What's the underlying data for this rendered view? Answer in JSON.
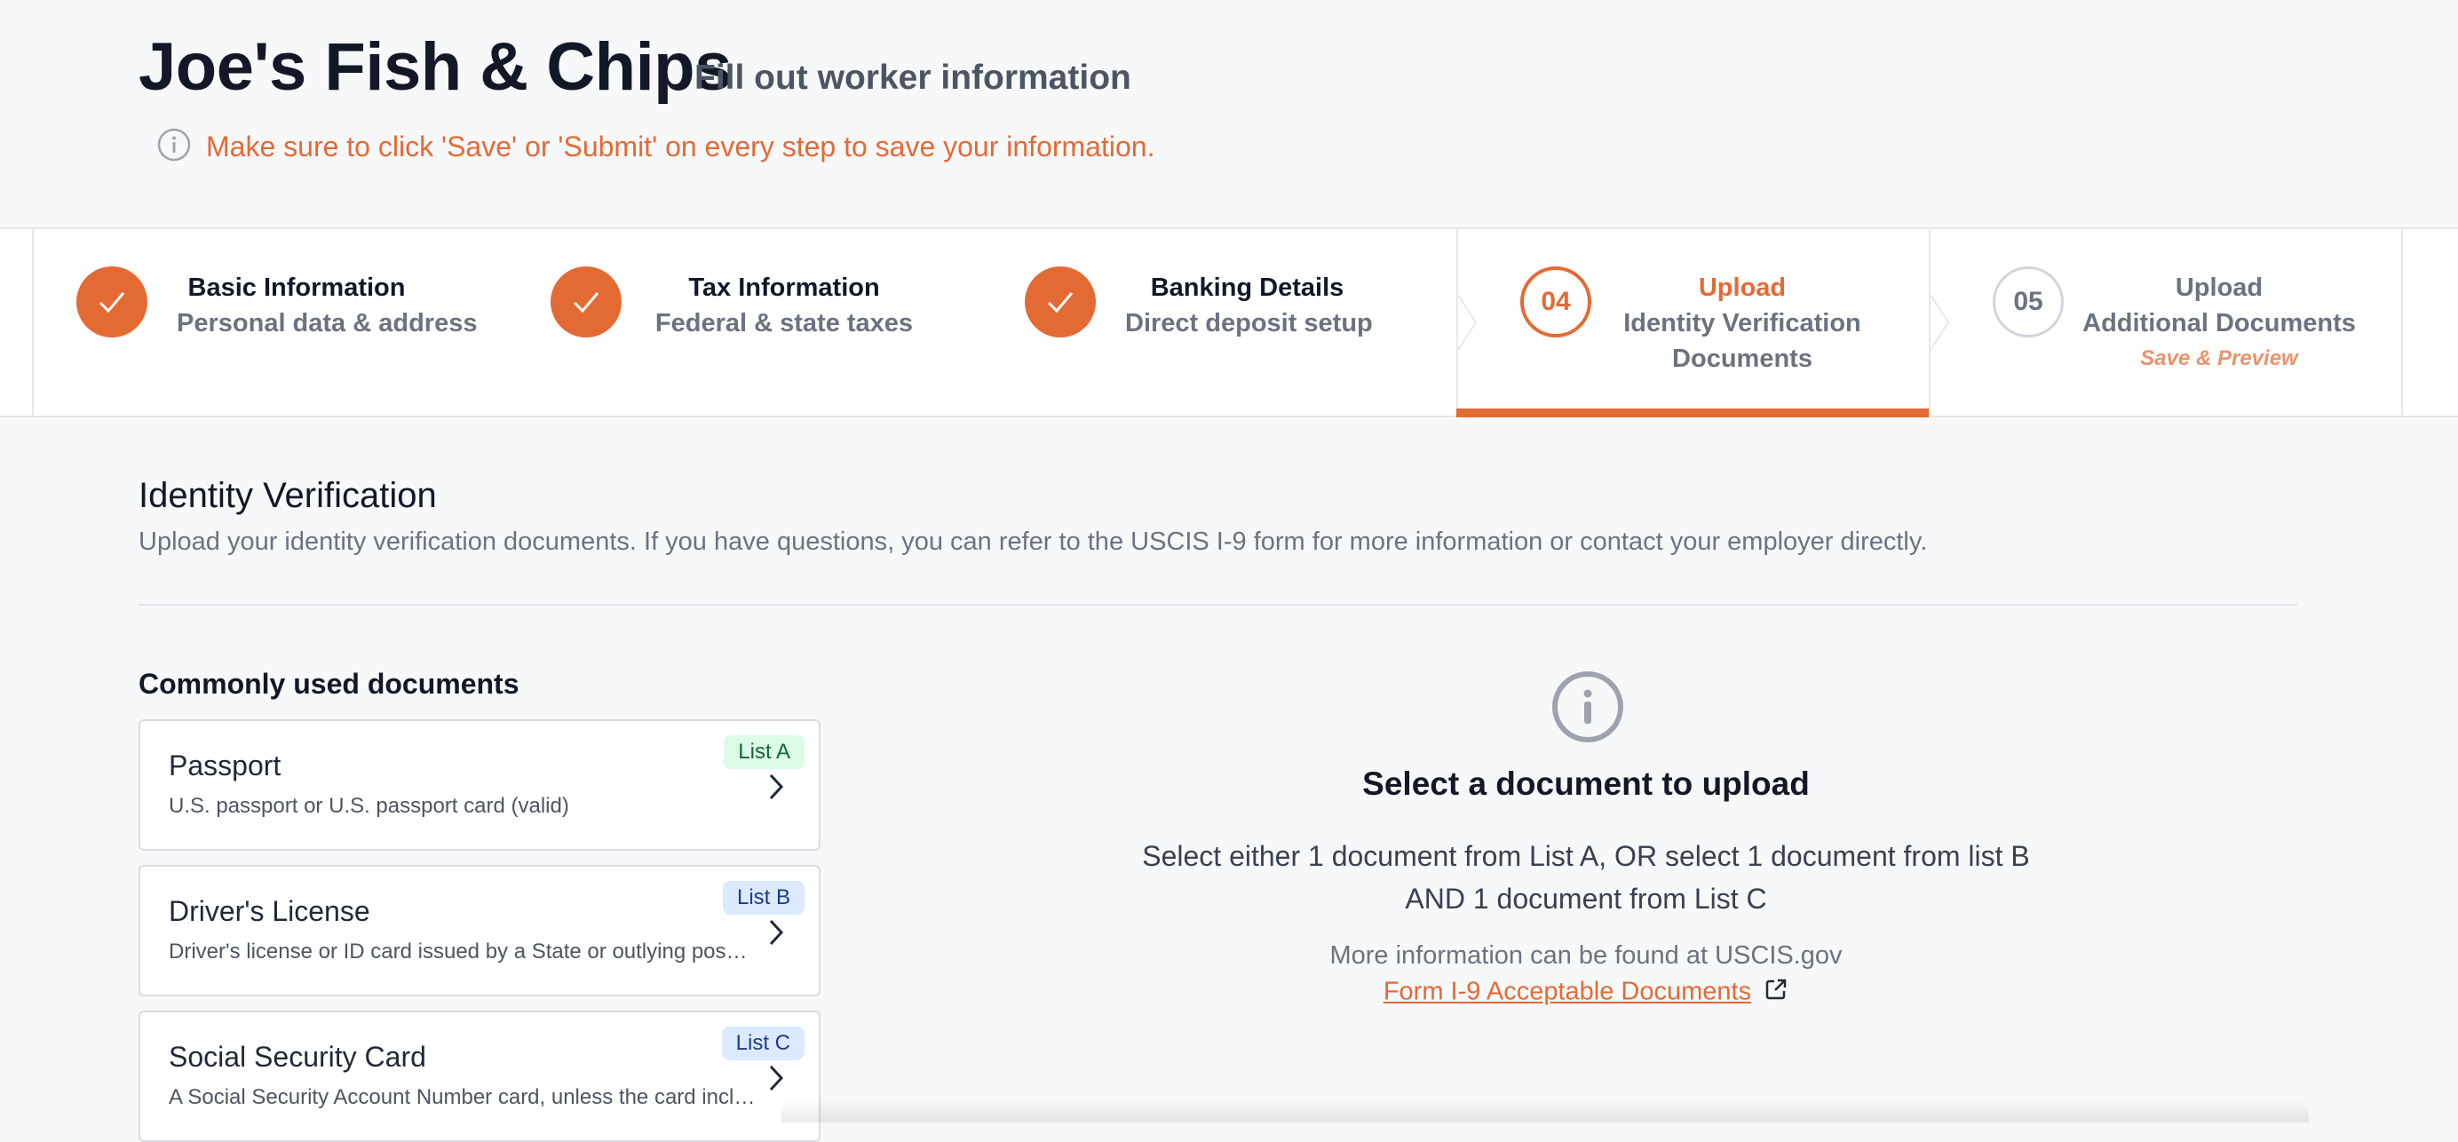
{
  "header": {
    "company": "Joe's Fish & Chips",
    "subtitle": "Fill out worker information",
    "notice": "Make sure to click 'Save' or 'Submit' on every step to save your information."
  },
  "steps": [
    {
      "status": "complete",
      "title": "Basic Information",
      "subtitle": "Personal data & address"
    },
    {
      "status": "complete",
      "title": "Tax Information",
      "subtitle": "Federal & state taxes"
    },
    {
      "status": "complete",
      "title": "Banking Details",
      "subtitle": "Direct deposit setup"
    },
    {
      "status": "active",
      "number": "04",
      "title": "Upload",
      "subtitle_line1": "Identity Verification",
      "subtitle_line2": "Documents"
    },
    {
      "status": "upcoming",
      "number": "05",
      "title": "Upload",
      "subtitle": "Additional Documents",
      "note": "Save & Preview"
    }
  ],
  "section": {
    "title": "Identity Verification",
    "description": "Upload your identity verification documents. If you have questions, you can refer to the USCIS I-9 form for more information or contact your employer directly."
  },
  "documents": {
    "heading": "Commonly used documents",
    "items": [
      {
        "name": "Passport",
        "description": "U.S. passport or U.S. passport card (valid)",
        "badge": "List A"
      },
      {
        "name": "Driver's License",
        "description": "Driver's license or ID card issued by a State or outlying possession of the United States",
        "badge": "List B"
      },
      {
        "name": "Social Security Card",
        "description": "A Social Security Account Number card, unless the card includes restrictions",
        "badge": "List C"
      }
    ]
  },
  "panel": {
    "title": "Select a document to upload",
    "body_line1": "Select either 1 document from List A, OR select 1 document from list B",
    "body_line2": "AND 1 document from List C",
    "more_info": "More information can be found at USCIS.gov",
    "link_text": "Form I-9 Acceptable Documents"
  },
  "colors": {
    "accent": "#e46a34",
    "list_a_badge": "#dcfce7",
    "list_bc_badge": "#dbeafe"
  },
  "icons": {
    "notice": "info-circle-icon",
    "complete_step": "checkmark-icon",
    "step_separator": "chevron-right-icon",
    "card_action": "chevron-right-icon",
    "panel": "info-circle-icon",
    "link": "external-link-icon"
  }
}
